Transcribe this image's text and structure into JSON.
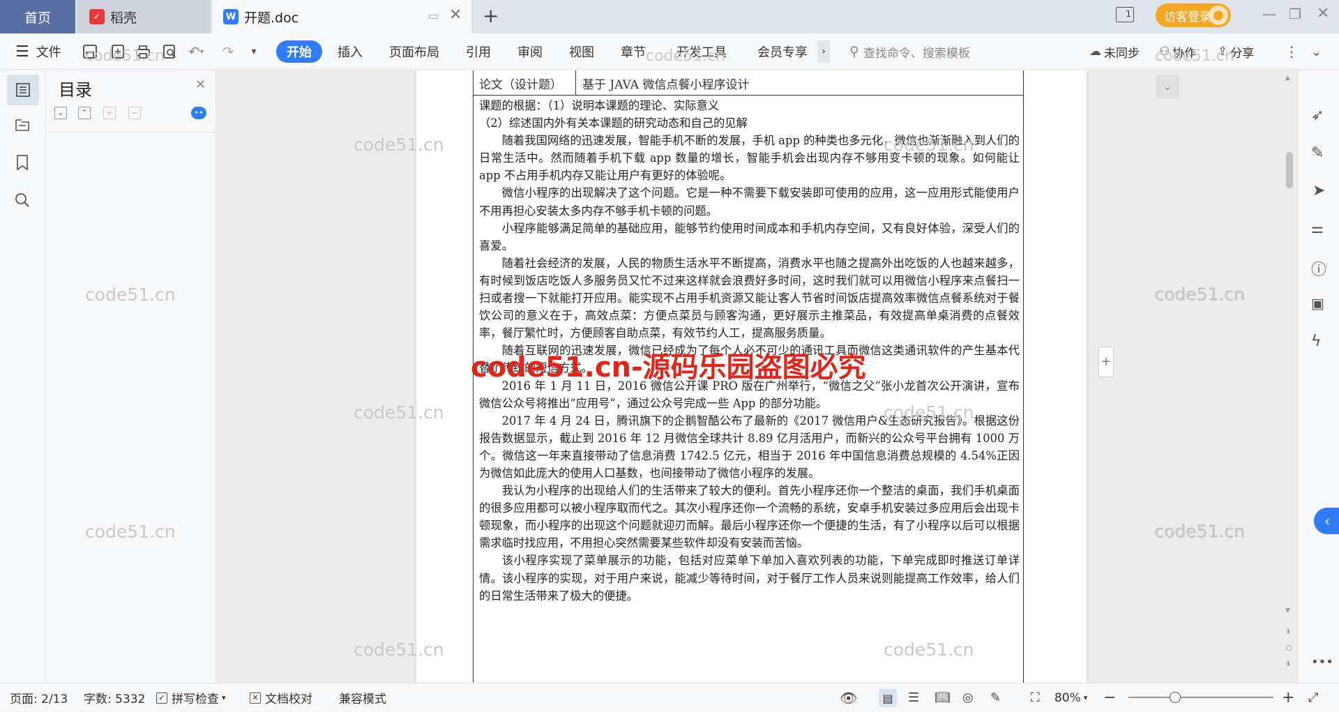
{
  "tabs": {
    "home": "首页",
    "daoke": "稻壳",
    "doc": "开题.doc",
    "new_tab": "+"
  },
  "titlebar": {
    "guest_login": "访客登录",
    "page_indicator": "1"
  },
  "toolbar": {
    "file": "文件",
    "menus": [
      "开始",
      "插入",
      "页面布局",
      "引用",
      "审阅",
      "视图",
      "章节",
      "开发工具",
      "会员专享"
    ],
    "active_menu": "开始",
    "search_placeholder": "查找命令、搜索模板",
    "unsynced": "未同步",
    "collaborate": "协作",
    "share": "分享"
  },
  "toc": {
    "title": "目录"
  },
  "document": {
    "row_label": "论文（设计题）",
    "row_value": "基于 JAVA 微信点餐小程序设计",
    "paragraphs": [
      {
        "indent": false,
        "text": "课题的根据：（1）说明本课题的理论、实际意义"
      },
      {
        "indent": false,
        "text": "（2）综述国内外有关本课题的研究动态和自己的见解"
      },
      {
        "indent": true,
        "text": "随着我国网络的迅速发展，智能手机不断的发展，手机 app 的种类也多元化，微信也渐渐融入到人们的日常生活中。然而随着手机下载 app 数量的增长，智能手机会出现内存不够用变卡顿的现象。如何能让 app 不占用手机内存又能让用户有更好的体验呢。"
      },
      {
        "indent": true,
        "text": "微信小程序的出现解决了这个问题。它是一种不需要下载安装即可使用的应用，这一应用形式能使用户不用再担心安装太多内存不够手机卡顿的问题。"
      },
      {
        "indent": true,
        "text": "小程序能够满足简单的基础应用，能够节约使用时间成本和手机内存空间，又有良好体验，深受人们的喜爱。"
      },
      {
        "indent": true,
        "text": "随着社会经济的发展，人民的物质生活水平不断提高，消费水平也随之提高外出吃饭的人也越来越多，有时候到饭店吃饭人多服务员又忙不过来这样就会浪费好多时间，这时我们就可以用微信小程序来点餐扫一扫或者搜一下就能打开应用。能实现不占用手机资源又能让客人节省时间饭店提高效率微信点餐系统对于餐饮公司的意义在于，高效点菜：方便点菜员与顾客沟通，更好展示主推菜品，有效提高单桌消费的点餐效率，餐厅繁忙时，方便顾客自助点菜，有效节约人工，提高服务质量。"
      },
      {
        "indent": true,
        "text": "随着互联网的迅速发展，微信已经成为了每个人必不可少的通讯工具而微信这类通讯软件的产生基本代替了传统的短信方式。"
      },
      {
        "indent": true,
        "text": "2016 年 1 月 11 日，2016 微信公开课 PRO 版在广州举行，“微信之父”张小龙首次公开演讲，宣布微信公众号将推出“应用号”，通过公众号完成一些 App 的部分功能。"
      },
      {
        "indent": true,
        "text": "2017 年 4 月 24 日，腾讯旗下的企鹅智酷公布了最新的《2017 微信用户&生态研究报告》。根据这份报告数据显示，截止到 2016 年 12 月微信全球共计 8.89 亿月活用户，而新兴的公众号平台拥有 1000 万个。微信这一年来直接带动了信息消费 1742.5 亿元，相当于 2016 年中国信息消费总规模的 4.54%正因为微信如此庞大的使用人口基数，也间接带动了微信小程序的发展。"
      },
      {
        "indent": true,
        "text": "我认为小程序的出现给人们的生活带来了较大的便利。首先小程序还你一个整洁的桌面，我们手机桌面的很多应用都可以被小程序取而代之。其次小程序还你一个流畅的系统，安卓手机安装过多应用后会出现卡顿现象，而小程序的出现这个问题就迎刃而解。最后小程序还你一个便捷的生活，有了小程序以后可以根据需求临时找应用，不用担心突然需要某些软件却没有安装而苦恼。"
      },
      {
        "indent": true,
        "text": "该小程序实现了菜单展示的功能，包括对应菜单下单加入喜欢列表的功能，下单完成即时推送订单详情。该小程序的实现，对于用户来说，能减少等待时间，对于餐厅工作人员来说则能提高工作效率，给人们的日常生活带来了极大的便捷。"
      }
    ]
  },
  "watermarks": {
    "faint": "code51.cn",
    "red": "code51.cn-源码乐园盗图必究"
  },
  "status": {
    "page": "页面: 2/13",
    "words": "字数: 5332",
    "spell": "拼写检查",
    "proof": "文档校对",
    "compat": "兼容模式",
    "zoom": "80%"
  },
  "colors": {
    "accent": "#2f7cf6",
    "home_tab": "#5a6ea6",
    "guest_btn": "#f5a623",
    "red_watermark": "#e0261b"
  }
}
